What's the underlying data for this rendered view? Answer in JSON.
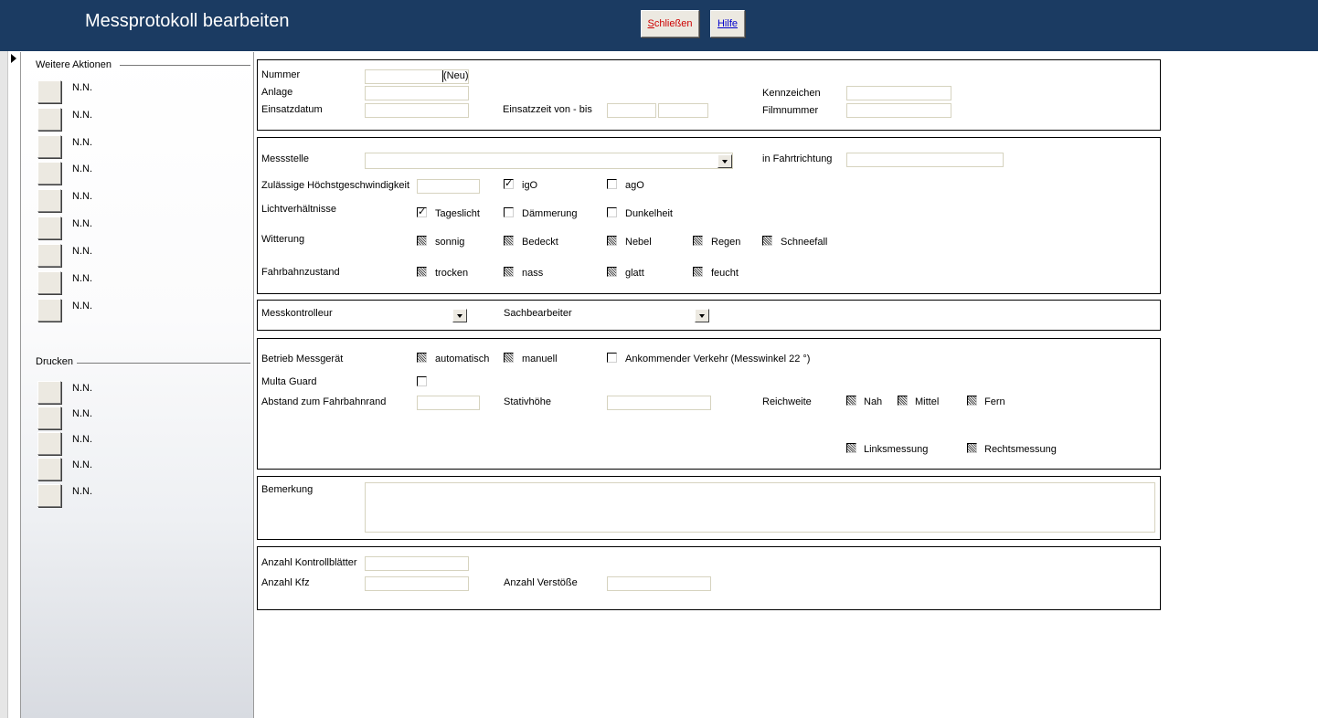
{
  "header": {
    "title": "Messprotokoll bearbeiten",
    "close_label_first": "S",
    "close_label_rest": "chließen",
    "help_label": "Hilfe"
  },
  "sidebar": {
    "weitere_aktionen_title": "Weitere Aktionen",
    "weitere_aktionen_items": [
      "N.N.",
      "N.N.",
      "N.N.",
      "N.N.",
      "N.N.",
      "N.N.",
      "N.N.",
      "N.N.",
      "N.N."
    ],
    "drucken_title": "Drucken",
    "drucken_items": [
      "N.N.",
      "N.N.",
      "N.N.",
      "N.N.",
      "N.N."
    ]
  },
  "panel1": {
    "nummer_label": "Nummer",
    "nummer_value": "",
    "nummer_suffix": "(Neu)",
    "anlage_label": "Anlage",
    "anlage_value": "",
    "einsatzdatum_label": "Einsatzdatum",
    "einsatzdatum_value": "",
    "einsatzzeit_label": "Einsatzzeit von - bis",
    "einsatzzeit_von": "",
    "einsatzzeit_bis": "",
    "kennzeichen_label": "Kennzeichen",
    "kennzeichen_value": "",
    "filmnummer_label": "Filmnummer",
    "filmnummer_value": ""
  },
  "panel2": {
    "messstelle_label": "Messstelle",
    "messstelle_value": "",
    "fahrtrichtung_label": "in Fahrtrichtung",
    "fahrtrichtung_value": "",
    "hoechstgeschw_label": "Zulässige Höchstgeschwindigkeit",
    "hoechstgeschw_value": "",
    "igo_label": "igO",
    "igo_checked": true,
    "ago_label": "agO",
    "ago_checked": false,
    "licht_label": "Lichtverhältnisse",
    "tageslicht_label": "Tageslicht",
    "tageslicht_checked": true,
    "daemmerung_label": "Dämmerung",
    "daemmerung_checked": false,
    "dunkelheit_label": "Dunkelheit",
    "dunkelheit_checked": false,
    "witterung_label": "Witterung",
    "sonnig_label": "sonnig",
    "bedeckt_label": "Bedeckt",
    "nebel_label": "Nebel",
    "regen_label": "Regen",
    "schneefall_label": "Schneefall",
    "fahrbahn_label": "Fahrbahnzustand",
    "trocken_label": "trocken",
    "nass_label": "nass",
    "glatt_label": "glatt",
    "feucht_label": "feucht"
  },
  "panel3": {
    "messkontrolleur_label": "Messkontrolleur",
    "sachbearbeiter_label": "Sachbearbeiter"
  },
  "panel4": {
    "betrieb_label": "Betrieb Messgerät",
    "automatisch_label": "automatisch",
    "manuell_label": "manuell",
    "ankommend_label": "Ankommender Verkehr (Messwinkel 22 °)",
    "ankommend_checked": false,
    "multa_label": "Multa Guard",
    "multa_checked": false,
    "abstand_label": "Abstand zum Fahrbahnrand",
    "abstand_value": "",
    "stativ_label": "Stativhöhe",
    "stativ_value": "",
    "reichweite_label": "Reichweite",
    "nah_label": "Nah",
    "mittel_label": "Mittel",
    "fern_label": "Fern",
    "links_label": "Linksmessung",
    "rechts_label": "Rechtsmessung"
  },
  "panel5": {
    "bemerkung_label": "Bemerkung",
    "bemerkung_value": ""
  },
  "panel6": {
    "kontrollblaetter_label": "Anzahl Kontrollblätter",
    "kontrollblaetter_value": "",
    "kfz_label": "Anzahl Kfz",
    "kfz_value": "",
    "verstoesse_label": "Anzahl Verstöße",
    "verstoesse_value": ""
  }
}
